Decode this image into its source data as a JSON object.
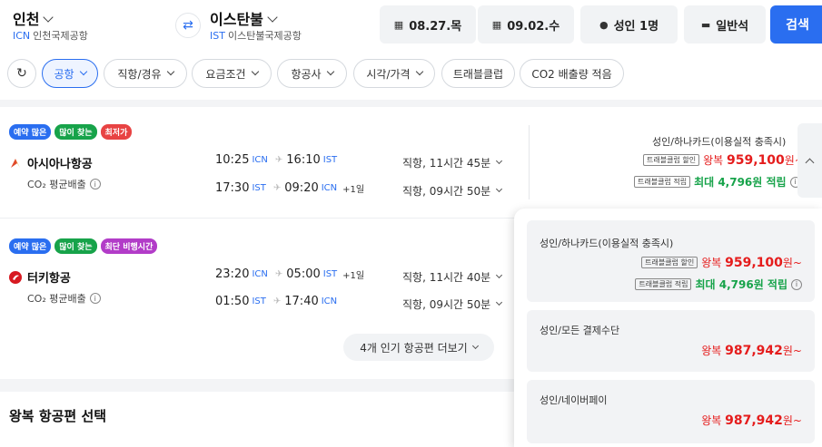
{
  "header": {
    "origin": {
      "city": "인천",
      "code": "ICN",
      "airport": "인천국제공항"
    },
    "destination": {
      "city": "이스탄불",
      "code": "IST",
      "airport": "이스탄불국제공항"
    },
    "depart_date": "08.27.목",
    "return_date": "09.02.수",
    "passengers": "성인 1명",
    "cabin": "일반석",
    "search_label": "검색"
  },
  "filters": [
    "공항",
    "직항/경유",
    "요금조건",
    "항공사",
    "시각/가격",
    "트래블클럽",
    "CO2 배출량 적음"
  ],
  "results": [
    {
      "badges": [
        "예약 많은",
        "많이 찾는",
        "최저가"
      ],
      "airline": "아시아나항공",
      "co2": "CO₂ 평균배출",
      "legs": [
        {
          "dep": "10:25",
          "dep_code": "ICN",
          "arr": "16:10",
          "arr_code": "IST",
          "plus": "",
          "duration": "직항, 11시간 45분"
        },
        {
          "dep": "17:30",
          "dep_code": "IST",
          "arr": "09:20",
          "arr_code": "ICN",
          "plus": "+1일",
          "duration": "직항, 09시간 50분"
        }
      ],
      "price_label": "성인/하나카드(이용실적 충족시)",
      "discount_tag": "트래블클럽 할인",
      "price_prefix": "왕복",
      "price": "959,100",
      "price_suffix": "원~",
      "reward_tag": "트래블클럽 적립",
      "reward": "최대 4,796원 적립"
    },
    {
      "badges": [
        "예약 많은",
        "많이 찾는",
        "최단 비행시간"
      ],
      "airline": "터키항공",
      "co2": "CO₂ 평균배출",
      "legs": [
        {
          "dep": "23:20",
          "dep_code": "ICN",
          "arr": "05:00",
          "arr_code": "IST",
          "plus": "+1일",
          "duration": "직항, 11시간 40분"
        },
        {
          "dep": "01:50",
          "dep_code": "IST",
          "arr": "17:40",
          "arr_code": "ICN",
          "plus": "",
          "duration": "직항, 09시간 50분"
        }
      ]
    }
  ],
  "more_button": "4개 인기 항공편 더보기",
  "return_section_title": "왕복 항공편 선택",
  "price_options": [
    {
      "label": "성인/하나카드(이용실적 충족시)",
      "tag": "트래블클럽 할인",
      "prefix": "왕복",
      "price": "959,100",
      "suffix": "원~",
      "reward_tag": "트래블클럽 적립",
      "reward": "최대 4,796원 적립"
    },
    {
      "label": "성인/모든 결제수단",
      "prefix": "왕복",
      "price": "987,942",
      "suffix": "원~"
    },
    {
      "label": "성인/네이버페이",
      "prefix": "왕복",
      "price": "987,942",
      "suffix": "원~"
    }
  ],
  "colors": {
    "accent": "#2a6ef0",
    "price": "#e51c1c",
    "reward": "#17a34a"
  }
}
